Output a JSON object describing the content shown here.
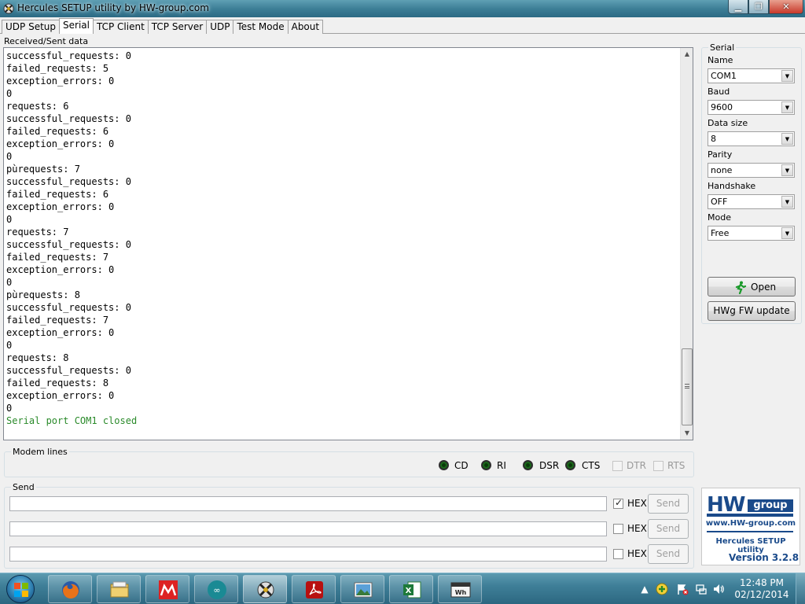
{
  "window": {
    "title": "Hercules SETUP utility by HW-group.com"
  },
  "tabs": [
    {
      "label": "UDP Setup",
      "active": false
    },
    {
      "label": "Serial",
      "active": true
    },
    {
      "label": "TCP Client",
      "active": false
    },
    {
      "label": "TCP Server",
      "active": false
    },
    {
      "label": "UDP",
      "active": false
    },
    {
      "label": "Test Mode",
      "active": false
    },
    {
      "label": "About",
      "active": false
    }
  ],
  "received": {
    "label": "Received/Sent data",
    "lines": [
      "successful_requests: 0",
      "failed_requests: 5",
      "exception_errors: 0",
      "0",
      "requests: 6",
      "successful_requests: 0",
      "failed_requests: 6",
      "exception_errors: 0",
      "0",
      "pùrequests: 7",
      "successful_requests: 0",
      "failed_requests: 6",
      "exception_errors: 0",
      "0",
      "requests: 7",
      "successful_requests: 0",
      "failed_requests: 7",
      "exception_errors: 0",
      "0",
      "pùrequests: 8",
      "successful_requests: 0",
      "failed_requests: 7",
      "exception_errors: 0",
      "0",
      "requests: 8",
      "successful_requests: 0",
      "failed_requests: 8",
      "exception_errors: 0",
      "0"
    ],
    "status_line": "Serial port COM1 closed",
    "status_color": "#2a8a2a"
  },
  "serial": {
    "legend": "Serial",
    "name_label": "Name",
    "name_value": "COM1",
    "baud_label": "Baud",
    "baud_value": "9600",
    "datasize_label": "Data size",
    "datasize_value": "8",
    "parity_label": "Parity",
    "parity_value": "none",
    "handshake_label": "Handshake",
    "handshake_value": "OFF",
    "mode_label": "Mode",
    "mode_value": "Free",
    "open_label": "Open",
    "fwupdate_label": "HWg FW update"
  },
  "modem": {
    "legend": "Modem lines",
    "leds": [
      "CD",
      "RI",
      "DSR",
      "CTS"
    ],
    "checks": [
      "DTR",
      "RTS"
    ]
  },
  "send": {
    "legend": "Send",
    "rows": [
      {
        "value": "",
        "hex_label": "HEX",
        "hex_checked": true,
        "send_label": "Send"
      },
      {
        "value": "",
        "hex_label": "HEX",
        "hex_checked": false,
        "send_label": "Send"
      },
      {
        "value": "",
        "hex_label": "HEX",
        "hex_checked": false,
        "send_label": "Send"
      }
    ]
  },
  "logo": {
    "hw": "HW",
    "group": "group",
    "www": "www.HW-group.com",
    "product": "Hercules SETUP utility",
    "version": "Version  3.2.8"
  },
  "taskbar": {
    "apps": [
      "start-orb",
      "firefox-icon",
      "file-explorer-icon",
      "mplab-ide-icon",
      "arduino-icon",
      "hercules-icon",
      "pdf-reader-icon",
      "image-viewer-icon",
      "excel-icon",
      "wintech-icon"
    ],
    "time": "12:48 PM",
    "date": "02/12/2014"
  }
}
